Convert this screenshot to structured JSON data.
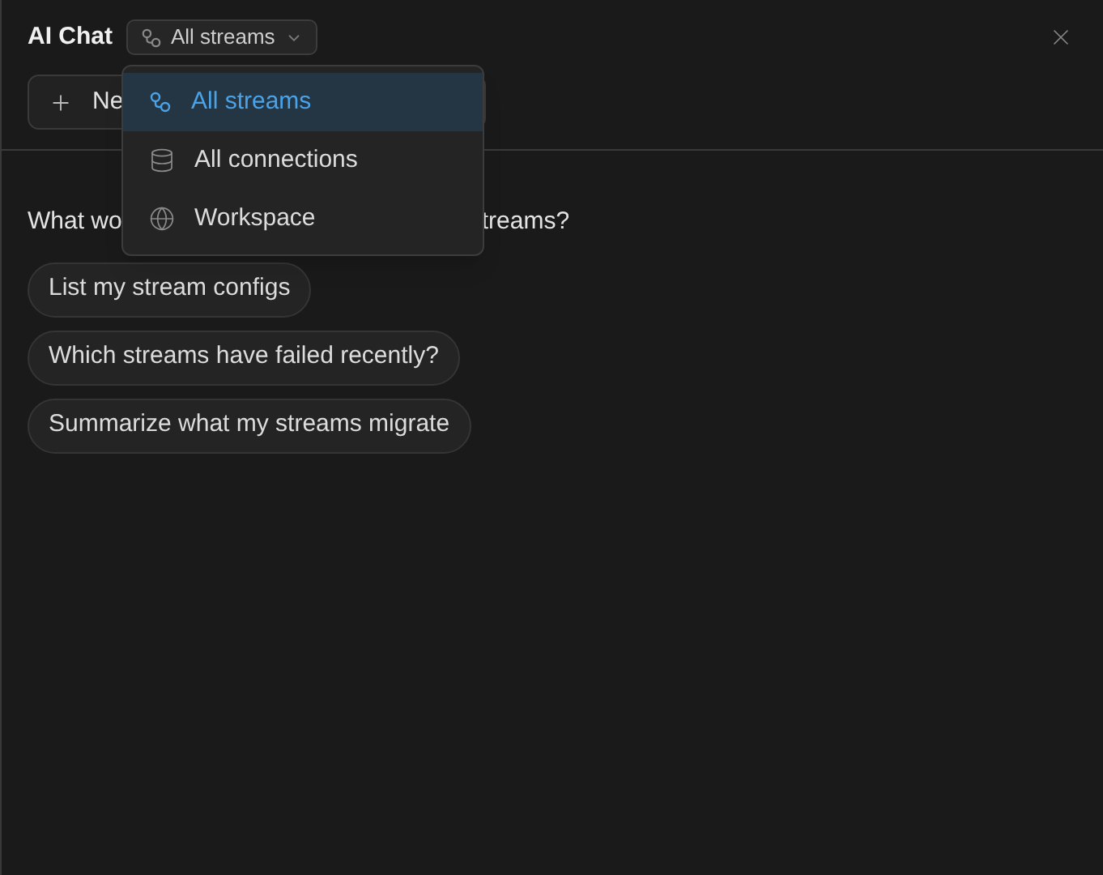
{
  "header": {
    "title": "AI Chat",
    "scope_selector": {
      "label": "All streams"
    }
  },
  "new_chat_button": {
    "label": "Ne"
  },
  "question_fragments": [
    "What wo",
    "treams?"
  ],
  "suggestions": [
    "List my stream configs",
    "Which streams have failed recently?",
    "Summarize what my streams migrate"
  ],
  "scope_menu": [
    {
      "kind": "streams",
      "label": "All streams",
      "selected": true
    },
    {
      "kind": "connections",
      "label": "All connections",
      "selected": false
    },
    {
      "kind": "workspace",
      "label": "Workspace",
      "selected": false
    }
  ]
}
